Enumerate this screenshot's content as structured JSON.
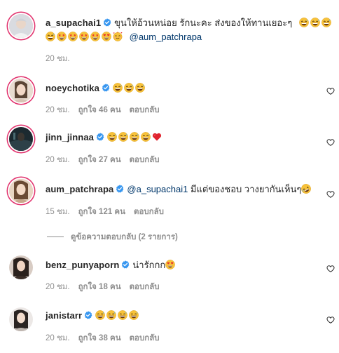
{
  "caption": {
    "username": "a_supachai1",
    "text": "ขุนให้อ้วนหน่อย รักนะคะ ส่งของให้ทานเยอะๆ",
    "mention": "@aum_patchrapa",
    "time": "20 ชม.",
    "emojis_line1": [
      "grin-sweat",
      "grin-sweat",
      "grin-sweat"
    ],
    "emojis_line2": [
      "grin-sweat",
      "star-eyes",
      "star-eyes",
      "star-eyes",
      "star-eyes",
      "heart-eyes",
      "hearts-face"
    ]
  },
  "comments": [
    {
      "username": "noeychotika",
      "text": "",
      "emojis": [
        "grin-sweat",
        "grin-sweat",
        "grin-sweat"
      ],
      "time": "20 ชม.",
      "likes": "ถูกใจ 46 คน",
      "reply": "ตอบกลับ"
    },
    {
      "username": "jinn_jinnaa",
      "text": "",
      "emojis": [
        "grin-sweat",
        "grin-sweat",
        "grin-sweat",
        "grin-sweat",
        "red-heart"
      ],
      "time": "20 ชม.",
      "likes": "ถูกใจ 27 คน",
      "reply": "ตอบกลับ"
    },
    {
      "username": "aum_patchrapa",
      "mention": "@a_supachai1",
      "text": "มีแต่ของชอบ วางยากันเห็นๆ",
      "emojis": [
        "rofl"
      ],
      "time": "15 ชม.",
      "likes": "ถูกใจ 121 คน",
      "reply": "ตอบกลับ",
      "view_replies": "ดูข้อความตอบกลับ (2 รายการ)"
    },
    {
      "username": "benz_punyaporn",
      "text": "น่ารักกก",
      "emojis": [
        "heart-eyes"
      ],
      "time": "20 ชม.",
      "likes": "ถูกใจ 18 คน",
      "reply": "ตอบกลับ"
    },
    {
      "username": "janistarr",
      "text": "",
      "emojis": [
        "grin-sweat",
        "grin-sweat",
        "grin-sweat",
        "grin-sweat"
      ],
      "time": "20 ชม.",
      "likes": "ถูกใจ 38 คน",
      "reply": "ตอบกลับ"
    }
  ],
  "colors": {
    "username": "#262626",
    "meta": "#8e8e8e",
    "mention": "#00376b",
    "verified": "#3897f0",
    "story_ring": "#e1306c"
  },
  "icons": {
    "verified": "verified-badge-icon",
    "like": "heart-outline-icon"
  }
}
